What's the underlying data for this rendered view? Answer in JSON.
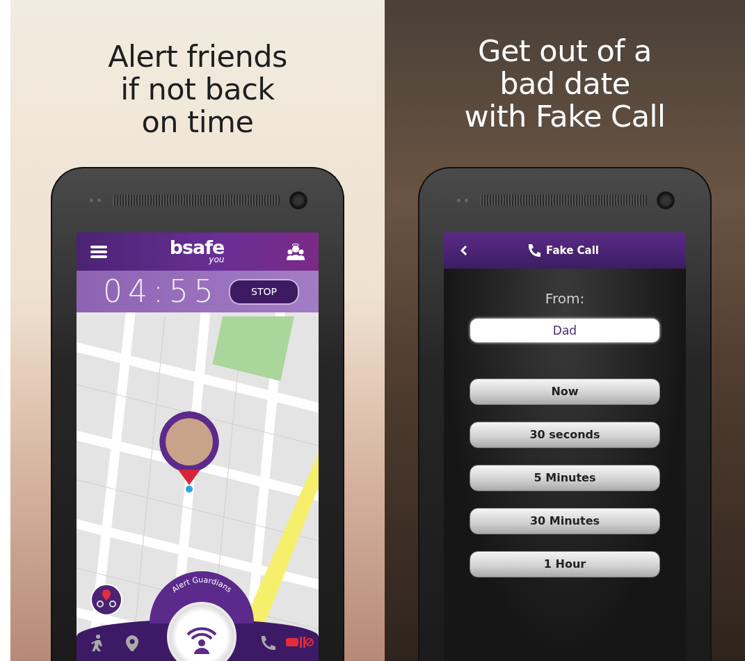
{
  "left_panel": {
    "headline": [
      "Alert friends",
      "if not back",
      "on time"
    ],
    "app_bar": {
      "logo": "bsafe",
      "logo_sub": "you"
    },
    "timer": {
      "time": "04:55",
      "button": "STOP"
    },
    "alert_button": {
      "label": "Alert Guardians"
    }
  },
  "right_panel": {
    "headline": [
      "Get out of a",
      "bad date",
      "with Fake Call"
    ],
    "header": {
      "title": "Fake Call"
    },
    "from_label": "From:",
    "caller_field": {
      "value": "Dad"
    },
    "delay_options": [
      {
        "label": "Now"
      },
      {
        "label": "30 seconds"
      },
      {
        "label": "5 Minutes"
      },
      {
        "label": "30 Minutes"
      },
      {
        "label": "1 Hour"
      }
    ]
  }
}
